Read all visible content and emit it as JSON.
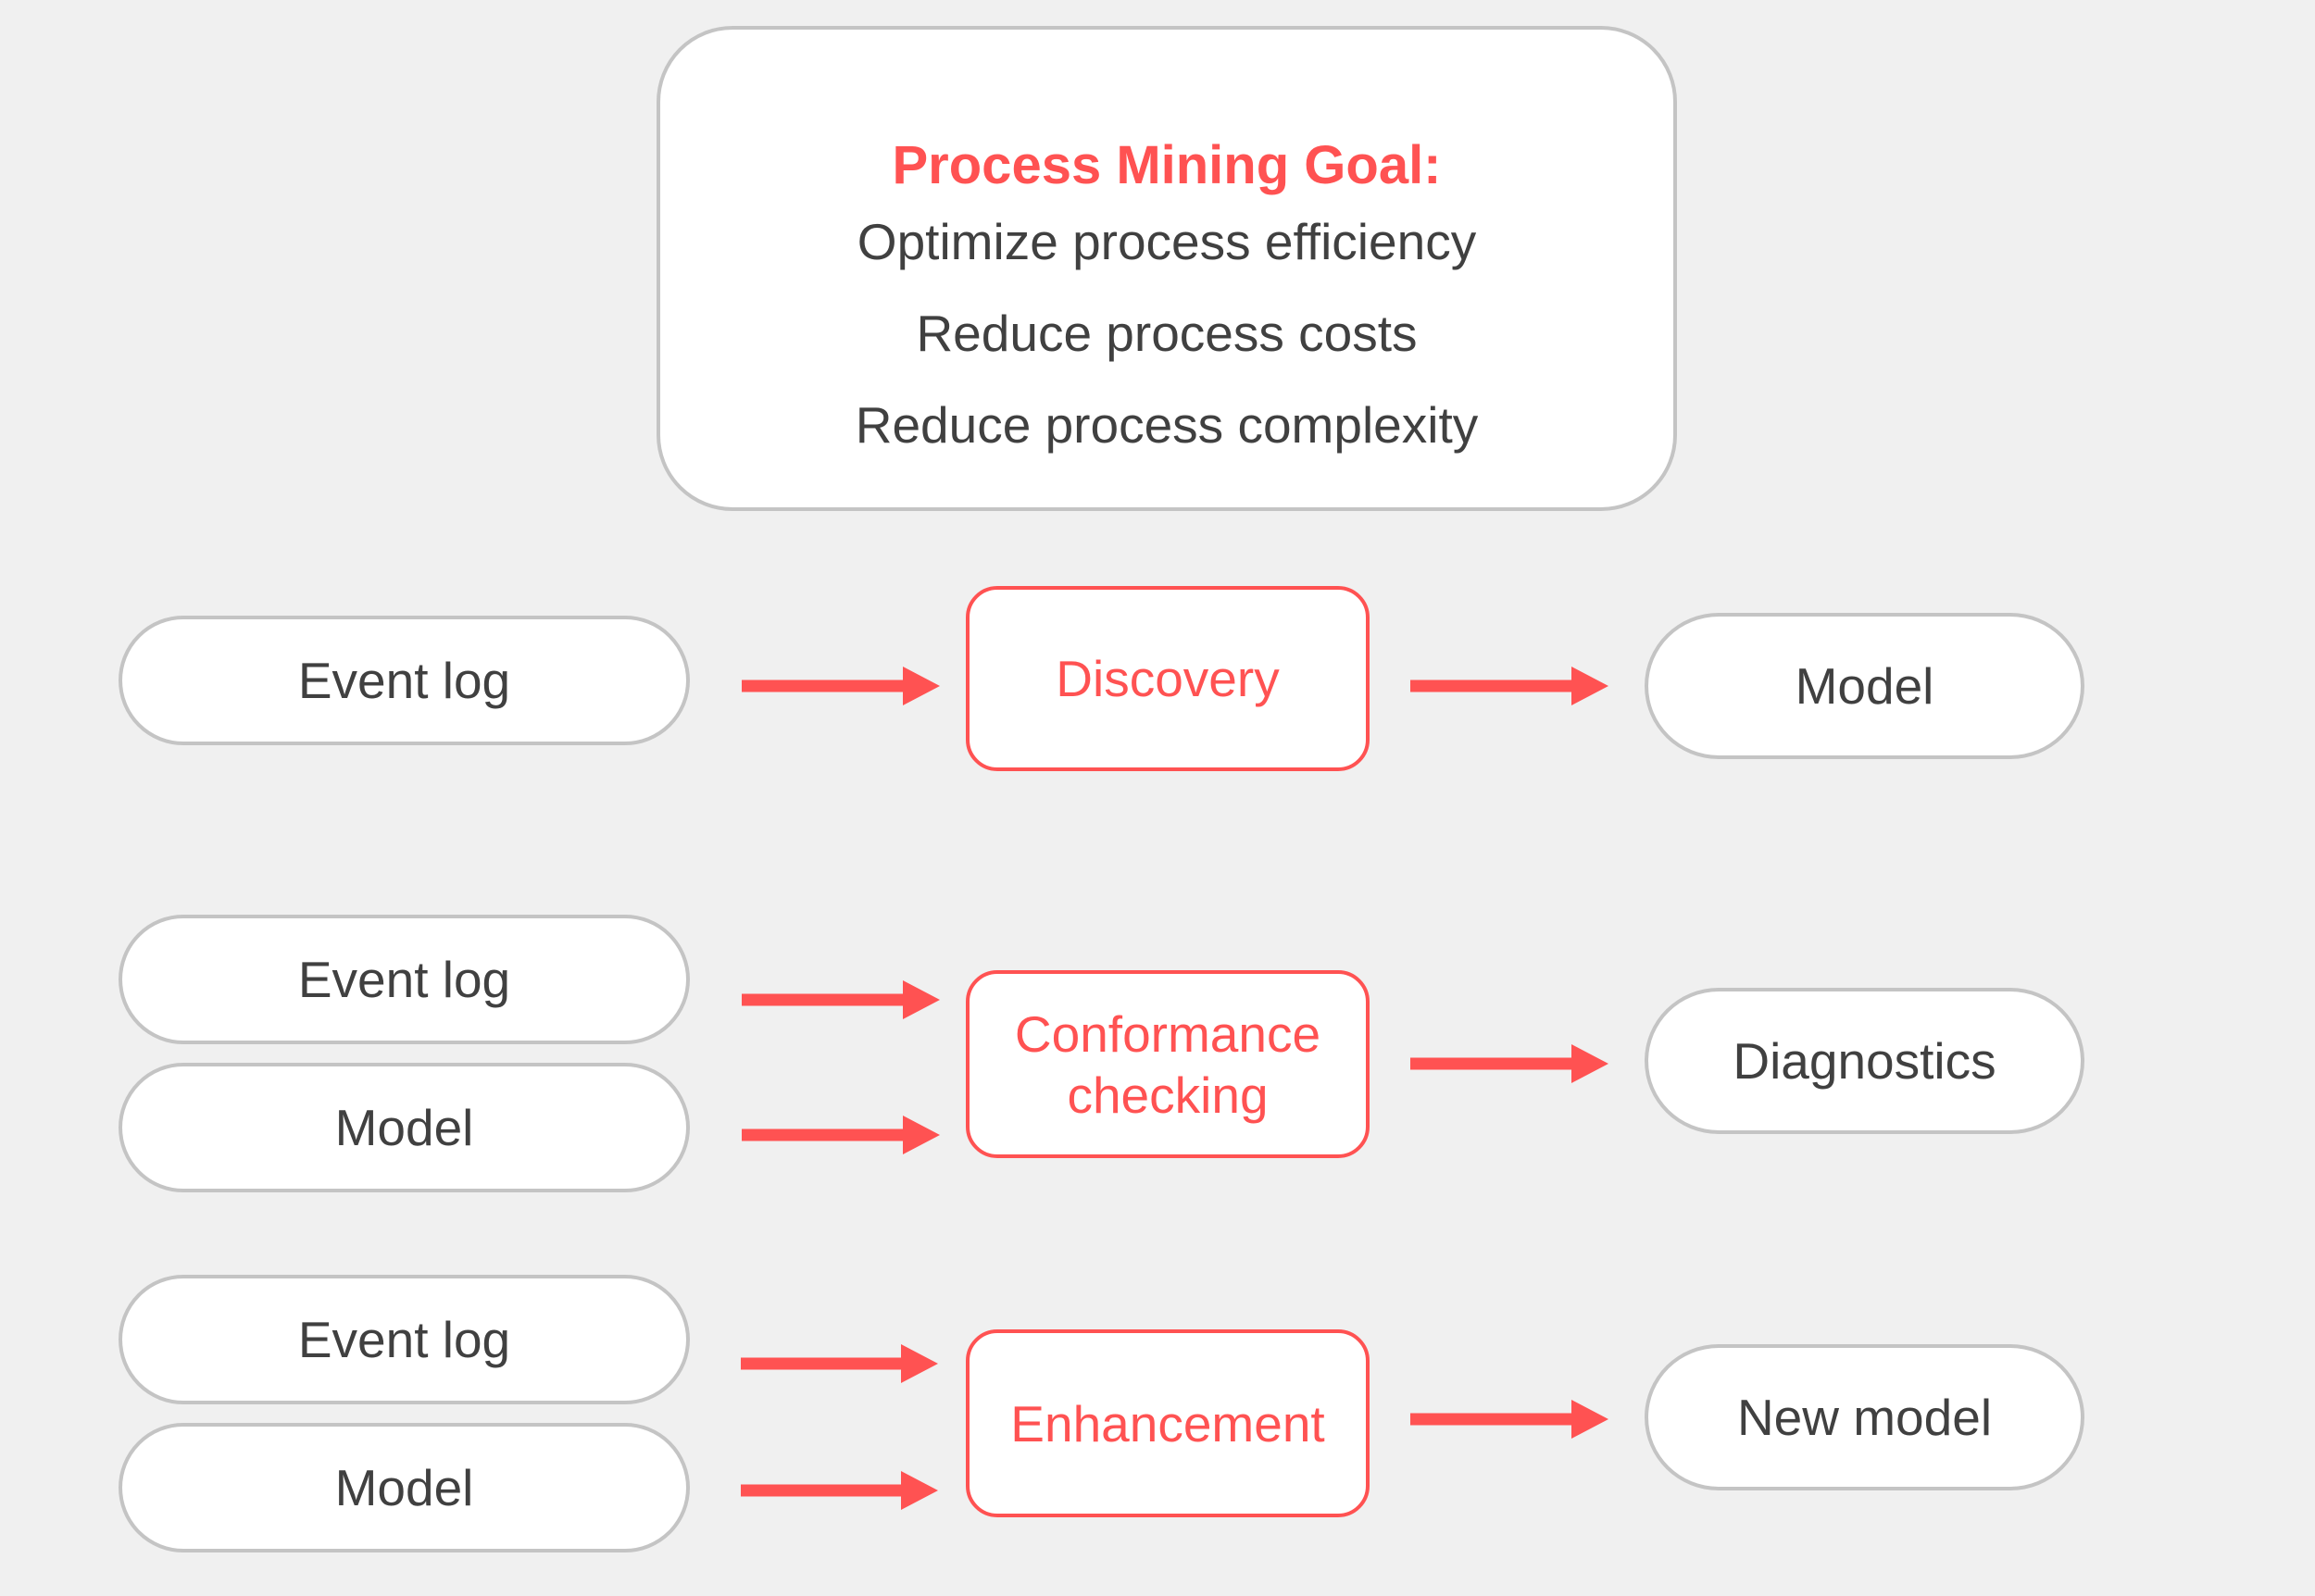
{
  "goal": {
    "title": "Process Mining Goal:",
    "lines": [
      "Optimize process efficiency",
      "Reduce process costs",
      "Reduce process complexity"
    ]
  },
  "rows": [
    {
      "inputs": [
        "Event log"
      ],
      "process": "Discovery",
      "output": "Model"
    },
    {
      "inputs": [
        "Event log",
        "Model"
      ],
      "process_lines": [
        "Conformance",
        "checking"
      ],
      "output": "Diagnostics"
    },
    {
      "inputs": [
        "Event log",
        "Model"
      ],
      "process": "Enhancement",
      "output": "New model"
    }
  ],
  "colors": {
    "accent": "#ff5252",
    "node_border": "#c4c4c4",
    "text": "#404040",
    "background": "#f0f0f0"
  }
}
